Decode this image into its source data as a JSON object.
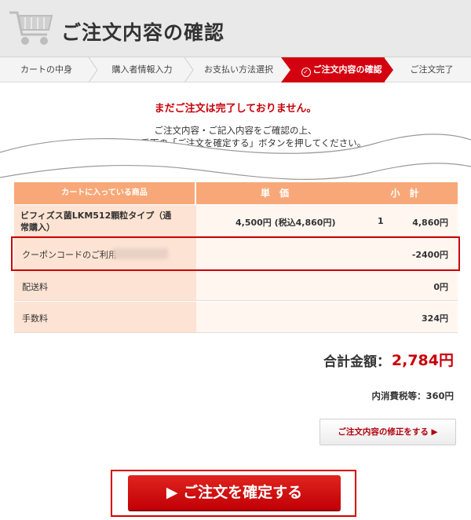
{
  "header": {
    "title": "ご注文内容の確認"
  },
  "steps": [
    {
      "label": "カートの中身"
    },
    {
      "label": "購入者情報入力"
    },
    {
      "label": "お支払い方法選択"
    },
    {
      "label": "ご注文内容の確認",
      "active": true
    },
    {
      "label": "ご注文完了"
    }
  ],
  "notice": {
    "title": "まだご注文は完了しておりません。",
    "line1": "ご注文内容・ご記入内容をご確認の上、",
    "line2": "ページ一番下の「ご注文を確定する」ボタンを押してください。"
  },
  "table": {
    "headers": {
      "product": "カートに入っている商品",
      "unit_price": "単　価",
      "subtotal": "小　計"
    },
    "item": {
      "name_line1": "ビフィズス菌LKM512顆粒タイプ（通",
      "name_line2": "常購入）",
      "price": "4,500円 (税込4,860円)",
      "qty": "1",
      "subtotal": "4,860円"
    },
    "coupon": {
      "label": "クーポンコードのご利用",
      "value": "-2400円"
    },
    "shipping": {
      "label": "配送料",
      "value": "0円"
    },
    "fee": {
      "label": "手数料",
      "value": "324円"
    }
  },
  "summary": {
    "total_label": "合計金額：",
    "total_value": "2,784円",
    "tax": "内消費税等：360円"
  },
  "buttons": {
    "edit": "ご注文内容の修正をする ▶",
    "confirm": "▶ ご注文を確定する"
  },
  "colors": {
    "accent": "#d3000f",
    "table_head": "#f8a878"
  }
}
